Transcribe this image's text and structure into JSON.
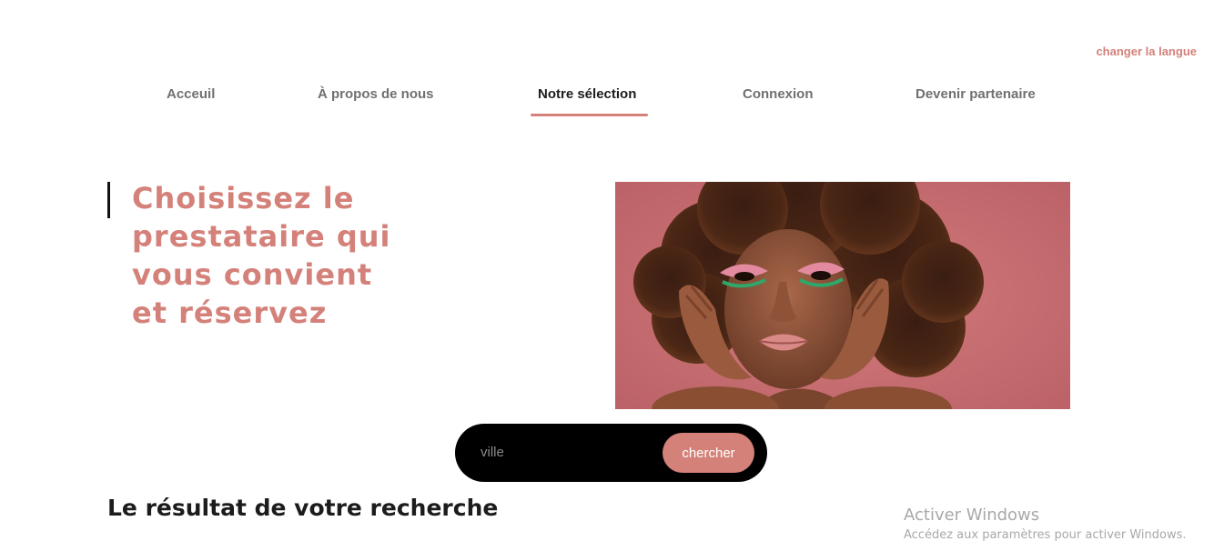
{
  "header": {
    "language_link": "changer la langue"
  },
  "nav": {
    "items": [
      {
        "label": "Acceuil"
      },
      {
        "label": "À propos de nous"
      },
      {
        "label": "Notre sélection"
      },
      {
        "label": "Connexion"
      },
      {
        "label": "Devenir partenaire"
      }
    ],
    "active_index": 2
  },
  "hero": {
    "title": "Choisissez le prestataire qui vous convient et réservez"
  },
  "search": {
    "placeholder": "ville",
    "value": "",
    "button_label": "chercher"
  },
  "results": {
    "title": "Le résultat de votre recherche"
  },
  "watermark": {
    "title": "Activer Windows",
    "subtitle": "Accédez aux paramètres pour activer Windows."
  },
  "colors": {
    "accent": "#d4817a",
    "search_bar": "#000000",
    "photo_background": "#c96a6f"
  }
}
